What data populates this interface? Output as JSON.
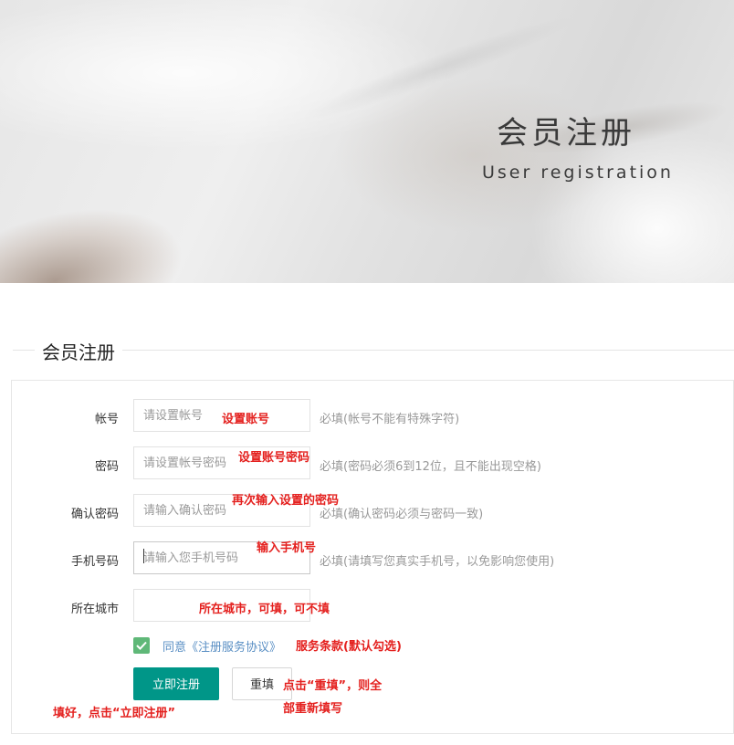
{
  "banner": {
    "title": "会员注册",
    "subtitle": "User registration"
  },
  "section": {
    "title": "会员注册"
  },
  "form": {
    "fields": [
      {
        "label": "帐号",
        "placeholder": "请设置帐号",
        "hint": "必填(帐号不能有特殊字符)",
        "annotation": "设置账号"
      },
      {
        "label": "密码",
        "placeholder": "请设置帐号密码",
        "hint": "必填(密码必须6到12位，且不能出现空格)",
        "annotation": "设置账号密码"
      },
      {
        "label": "确认密码",
        "placeholder": "请输入确认密码",
        "hint": "必填(确认密码必须与密码一致)",
        "annotation": "再次输入设置的密码"
      },
      {
        "label": "手机号码",
        "placeholder": "请输入您手机号码",
        "hint": "必填(请填写您真实手机号，以免影响您使用)",
        "annotation": "输入手机号"
      },
      {
        "label": "所在城市",
        "placeholder": "",
        "hint": "",
        "annotation": "所在城市，可填，可不填"
      }
    ],
    "agreement": {
      "checked": true,
      "text": "同意《注册服务协议》",
      "annotation": "服务条款(默认勾选)"
    },
    "submit_label": "立即注册",
    "reset_label": "重填",
    "submit_annotation": "填好，点击“立即注册”",
    "reset_annotation_line1": "点击“重填”，则全",
    "reset_annotation_line2": "部重新填写"
  },
  "colors": {
    "primary": "#009688",
    "checkbox": "#5fb878",
    "annotation": "#e4201e",
    "link": "#5a8fc4"
  }
}
